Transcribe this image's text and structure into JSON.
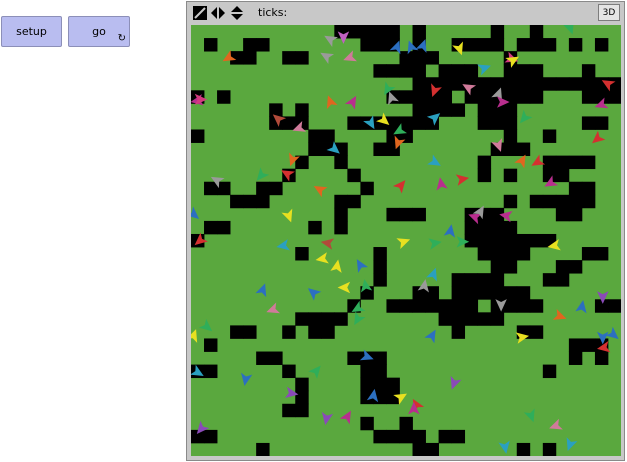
{
  "buttons": {
    "setup_label": "setup",
    "go_label": "go",
    "go_loop_glyph": "↻"
  },
  "view": {
    "ticks_label": "ticks:",
    "ticks_value": "",
    "three_d_label": "3D",
    "icons": [
      "resize-icon",
      "horizontal-arrows-icon",
      "vertical-arrows-icon"
    ]
  },
  "world": {
    "cols": 33,
    "rows": 33,
    "colors": {
      "grass": "#5aa83e",
      "empty": "#000000"
    },
    "grid": [
      "000000000001111101000001001000000",
      "010011000000011101001111011101010",
      "000110011000000011100000100000000",
      "000000000000001111011100111000100",
      "000000000000000001111111111111111",
      "101000000000000111110111111000111",
      "000000101000000001111011100000000",
      "000000111000111111100011100000110",
      "100000000110000110000000100100000",
      "000000000111001100000001110000000",
      "000000001001000000000010000111100",
      "000000010000100000000010100110000",
      "011001100000010000000000000001100",
      "000111000001100000000000101111100",
      "000000000001000111000111000011000",
      "011000000101000000000111100000000",
      "100000000000000000000111111100000",
      "000000001000001000000011110000110",
      "000000000000001000000001100011000",
      "000000000000001000001111000110000",
      "000000000000010001101111110000000",
      "000000000000100111111101111000011",
      "000000001111000000011111000000000",
      "000110010110000000001000011000000",
      "010000000000000000000000000001110",
      "000001100000111000000000000001010",
      "110000010000011000000000000100000",
      "000000001000011100000000000000000",
      "000000001000011100000000000000000",
      "000000011000000000000000000000000",
      "000000000000010010000000000000000",
      "110000000000001111011000000000000",
      "000001000000000001100000010100000"
    ]
  },
  "turtles": [
    {
      "x": 10.7,
      "y": 1.1,
      "h": 300,
      "c": "#9a9a9a"
    },
    {
      "x": 11.7,
      "y": 0.9,
      "h": 180,
      "c": "#c060c0"
    },
    {
      "x": 15.8,
      "y": 1.7,
      "h": 20,
      "c": "#2c6fc0"
    },
    {
      "x": 16.9,
      "y": 1.7,
      "h": 340,
      "c": "#2c6fc0"
    },
    {
      "x": 17.8,
      "y": 1.6,
      "h": 20,
      "c": "#2c6fc0"
    },
    {
      "x": 2.9,
      "y": 2.5,
      "h": 240,
      "c": "#e0661f"
    },
    {
      "x": 20.6,
      "y": 1.8,
      "h": 160,
      "c": "#e8e020"
    },
    {
      "x": 24.6,
      "y": 2.6,
      "h": 110,
      "c": "#d33b7e"
    },
    {
      "x": 24.7,
      "y": 2.7,
      "h": 60,
      "c": "#e8e020"
    },
    {
      "x": 29.1,
      "y": 0.2,
      "h": 160,
      "c": "#2fae5a"
    },
    {
      "x": 10.4,
      "y": 2.4,
      "h": 300,
      "c": "#9a9a9a"
    },
    {
      "x": 12.2,
      "y": 2.5,
      "h": 250,
      "c": "#d07a9a"
    },
    {
      "x": 22.5,
      "y": 3.3,
      "h": 70,
      "c": "#2aa0c0"
    },
    {
      "x": 21.3,
      "y": 4.8,
      "h": 300,
      "c": "#d07a9a"
    },
    {
      "x": 23.6,
      "y": 5.3,
      "h": 20,
      "c": "#9a9a9a"
    },
    {
      "x": 32.0,
      "y": 4.5,
      "h": 300,
      "c": "#d43030"
    },
    {
      "x": 31.5,
      "y": 6.1,
      "h": 250,
      "c": "#b82e8e"
    },
    {
      "x": 0.5,
      "y": 5.8,
      "h": 260,
      "c": "#b82e8e"
    },
    {
      "x": 0.7,
      "y": 5.7,
      "h": 90,
      "c": "#d33b7e"
    },
    {
      "x": 10.7,
      "y": 5.9,
      "h": 340,
      "c": "#e0661f"
    },
    {
      "x": 12.4,
      "y": 5.9,
      "h": 30,
      "c": "#b82e8e"
    },
    {
      "x": 15.1,
      "y": 4.9,
      "h": 210,
      "c": "#2fae5a"
    },
    {
      "x": 15.4,
      "y": 5.6,
      "h": 340,
      "c": "#9a9a9a"
    },
    {
      "x": 18.7,
      "y": 5.0,
      "h": 200,
      "c": "#d43030"
    },
    {
      "x": 23.9,
      "y": 5.9,
      "h": 90,
      "c": "#b82e8e"
    },
    {
      "x": 6.7,
      "y": 7.2,
      "h": 310,
      "c": "#b24a3a"
    },
    {
      "x": 8.3,
      "y": 7.9,
      "h": 250,
      "c": "#d07a9a"
    },
    {
      "x": 13.8,
      "y": 7.5,
      "h": 150,
      "c": "#2aa0c0"
    },
    {
      "x": 14.8,
      "y": 7.3,
      "h": 130,
      "c": "#e8e020"
    },
    {
      "x": 16.0,
      "y": 8.1,
      "h": 240,
      "c": "#2fae5a"
    },
    {
      "x": 18.7,
      "y": 7.1,
      "h": 50,
      "c": "#2aa0c0"
    },
    {
      "x": 25.6,
      "y": 7.1,
      "h": 220,
      "c": "#2fae5a"
    },
    {
      "x": 15.9,
      "y": 9.0,
      "h": 200,
      "c": "#e0661f"
    },
    {
      "x": 11.0,
      "y": 9.5,
      "h": 130,
      "c": "#2aa0c0"
    },
    {
      "x": 23.6,
      "y": 9.2,
      "h": 160,
      "c": "#d07a9a"
    },
    {
      "x": 31.2,
      "y": 8.7,
      "h": 230,
      "c": "#d43030"
    },
    {
      "x": 7.8,
      "y": 10.3,
      "h": 200,
      "c": "#e0661f"
    },
    {
      "x": 7.4,
      "y": 11.4,
      "h": 300,
      "c": "#d43030"
    },
    {
      "x": 18.7,
      "y": 10.5,
      "h": 120,
      "c": "#2aa0c0"
    },
    {
      "x": 25.4,
      "y": 10.4,
      "h": 30,
      "c": "#e0661f"
    },
    {
      "x": 26.6,
      "y": 10.5,
      "h": 240,
      "c": "#d43030"
    },
    {
      "x": 2.0,
      "y": 11.9,
      "h": 300,
      "c": "#9a9a9a"
    },
    {
      "x": 5.4,
      "y": 11.5,
      "h": 220,
      "c": "#2fae5a"
    },
    {
      "x": 9.9,
      "y": 12.6,
      "h": 300,
      "c": "#e0661f"
    },
    {
      "x": 16.1,
      "y": 12.3,
      "h": 40,
      "c": "#d43030"
    },
    {
      "x": 19.2,
      "y": 12.2,
      "h": 350,
      "c": "#b82e8e"
    },
    {
      "x": 20.8,
      "y": 11.8,
      "h": 80,
      "c": "#d43030"
    },
    {
      "x": 27.6,
      "y": 12.1,
      "h": 240,
      "c": "#b82e8e"
    },
    {
      "x": 7.5,
      "y": 14.6,
      "h": 160,
      "c": "#e8e020"
    },
    {
      "x": 0.2,
      "y": 14.5,
      "h": 130,
      "c": "#2c6fc0"
    },
    {
      "x": 21.8,
      "y": 14.7,
      "h": 290,
      "c": "#b82e8e"
    },
    {
      "x": 24.2,
      "y": 14.6,
      "h": 280,
      "c": "#b82e8e"
    },
    {
      "x": 19.9,
      "y": 15.8,
      "h": 10,
      "c": "#2c6fc0"
    },
    {
      "x": 22.2,
      "y": 14.3,
      "h": 30,
      "c": "#9a9a9a"
    },
    {
      "x": 0.7,
      "y": 16.5,
      "h": 230,
      "c": "#d43030"
    },
    {
      "x": 7.1,
      "y": 16.9,
      "h": 260,
      "c": "#2aa0c0"
    },
    {
      "x": 10.5,
      "y": 16.7,
      "h": 280,
      "c": "#b24a3a"
    },
    {
      "x": 16.3,
      "y": 16.6,
      "h": 70,
      "c": "#e8e020"
    },
    {
      "x": 18.7,
      "y": 16.7,
      "h": 80,
      "c": "#2fae5a"
    },
    {
      "x": 20.8,
      "y": 16.6,
      "h": 90,
      "c": "#2fae5a"
    },
    {
      "x": 27.9,
      "y": 16.9,
      "h": 260,
      "c": "#e8e020"
    },
    {
      "x": 10.1,
      "y": 17.9,
      "h": 260,
      "c": "#e8e020"
    },
    {
      "x": 13.0,
      "y": 18.4,
      "h": 330,
      "c": "#2c6fc0"
    },
    {
      "x": 11.2,
      "y": 18.5,
      "h": 10,
      "c": "#e8e020"
    },
    {
      "x": 18.6,
      "y": 19.1,
      "h": 20,
      "c": "#2aa0c0"
    },
    {
      "x": 17.9,
      "y": 20.0,
      "h": 10,
      "c": "#9a9a9a"
    },
    {
      "x": 13.4,
      "y": 20.0,
      "h": 350,
      "c": "#2fae5a"
    },
    {
      "x": 11.8,
      "y": 20.1,
      "h": 270,
      "c": "#e8e020"
    },
    {
      "x": 5.5,
      "y": 20.3,
      "h": 20,
      "c": "#2c6fc0"
    },
    {
      "x": 9.4,
      "y": 20.5,
      "h": 310,
      "c": "#2c6fc0"
    },
    {
      "x": 31.6,
      "y": 20.8,
      "h": 180,
      "c": "#8a4ab8"
    },
    {
      "x": 30.0,
      "y": 21.6,
      "h": 10,
      "c": "#2c6fc0"
    },
    {
      "x": 23.8,
      "y": 21.4,
      "h": 180,
      "c": "#9a9a9a"
    },
    {
      "x": 6.3,
      "y": 21.8,
      "h": 250,
      "c": "#d07a9a"
    },
    {
      "x": 12.8,
      "y": 21.7,
      "h": 240,
      "c": "#2fae5a"
    },
    {
      "x": 12.8,
      "y": 22.5,
      "h": 210,
      "c": "#2fae5a"
    },
    {
      "x": 28.3,
      "y": 22.3,
      "h": 110,
      "c": "#e0661f"
    },
    {
      "x": 1.2,
      "y": 23.1,
      "h": 130,
      "c": "#2fae5a"
    },
    {
      "x": 0.2,
      "y": 23.8,
      "h": 20,
      "c": "#e8e020"
    },
    {
      "x": 18.5,
      "y": 23.8,
      "h": 30,
      "c": "#2c6fc0"
    },
    {
      "x": 25.4,
      "y": 23.9,
      "h": 80,
      "c": "#e8e020"
    },
    {
      "x": 31.6,
      "y": 23.9,
      "h": 180,
      "c": "#2c6fc0"
    },
    {
      "x": 32.4,
      "y": 23.7,
      "h": 130,
      "c": "#2c6fc0"
    },
    {
      "x": 31.7,
      "y": 24.7,
      "h": 260,
      "c": "#d43030"
    },
    {
      "x": 13.5,
      "y": 25.4,
      "h": 110,
      "c": "#2c6fc0"
    },
    {
      "x": 9.6,
      "y": 26.5,
      "h": 40,
      "c": "#2fae5a"
    },
    {
      "x": 0.5,
      "y": 26.6,
      "h": 120,
      "c": "#2aa0c0"
    },
    {
      "x": 4.2,
      "y": 27.1,
      "h": 190,
      "c": "#2c6fc0"
    },
    {
      "x": 20.2,
      "y": 27.4,
      "h": 200,
      "c": "#8a4ab8"
    },
    {
      "x": 7.7,
      "y": 28.2,
      "h": 100,
      "c": "#8a4ab8"
    },
    {
      "x": 14.0,
      "y": 28.4,
      "h": 10,
      "c": "#2c6fc0"
    },
    {
      "x": 16.1,
      "y": 28.5,
      "h": 60,
      "c": "#e8e020"
    },
    {
      "x": 17.3,
      "y": 29.1,
      "h": 330,
      "c": "#d43030"
    },
    {
      "x": 17.1,
      "y": 29.4,
      "h": 0,
      "c": "#b82e8e"
    },
    {
      "x": 10.4,
      "y": 30.1,
      "h": 190,
      "c": "#8a4ab8"
    },
    {
      "x": 12.0,
      "y": 30.0,
      "h": 30,
      "c": "#b82e8e"
    },
    {
      "x": 26.1,
      "y": 29.9,
      "h": 160,
      "c": "#2fae5a"
    },
    {
      "x": 28.0,
      "y": 30.7,
      "h": 250,
      "c": "#d07a9a"
    },
    {
      "x": 0.8,
      "y": 30.9,
      "h": 220,
      "c": "#8a4ab8"
    },
    {
      "x": 24.1,
      "y": 32.3,
      "h": 170,
      "c": "#2aa0c0"
    },
    {
      "x": 29.1,
      "y": 32.1,
      "h": 200,
      "c": "#2aa0c0"
    }
  ]
}
